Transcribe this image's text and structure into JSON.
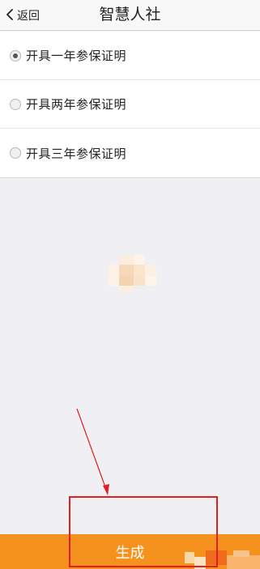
{
  "navbar": {
    "back_label": "返回",
    "title": "智慧人社"
  },
  "options": [
    {
      "label": "开具一年参保证明",
      "selected": true
    },
    {
      "label": "开具两年参保证明",
      "selected": false
    },
    {
      "label": "开具三年参保证明",
      "selected": false
    }
  ],
  "footer": {
    "generate_label": "生成"
  },
  "colors": {
    "accent": "#f5921e",
    "annotation": "#e02020",
    "background": "#efeff4"
  },
  "icons": {
    "back": "chevron-left-icon",
    "radio_on": "radio-selected-icon",
    "radio_off": "radio-unselected-icon"
  }
}
